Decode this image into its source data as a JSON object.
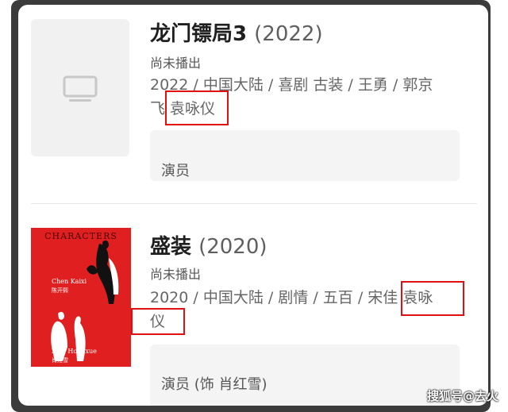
{
  "movies": [
    {
      "title": "龙门镖局3",
      "year": "(2022)",
      "status": "尚未播出",
      "meta_line1": "2022 / 中国大陆 / 喜剧 古装 / 王勇 / 郭京",
      "meta_line2": "飞 袁咏仪",
      "role": "演员"
    },
    {
      "title": "盛装",
      "year": "(2020)",
      "status": "尚未播出",
      "meta_line1": "2020 / 中国大陆 / 剧情 / 五百 / 宋佳 袁咏",
      "meta_line2": "仪",
      "role": "演员 (饰 肖红雪)",
      "poster": {
        "title": "CHARACTERS",
        "name1": "Chen Kaixi",
        "name1_cn": "陈开熙",
        "name2": "Xiao Hongxue",
        "name2_cn": "肖红雪"
      }
    }
  ],
  "watermark": "搜狐号@去火",
  "colors": {
    "highlight": "#e01010",
    "poster_red": "#e02020"
  }
}
